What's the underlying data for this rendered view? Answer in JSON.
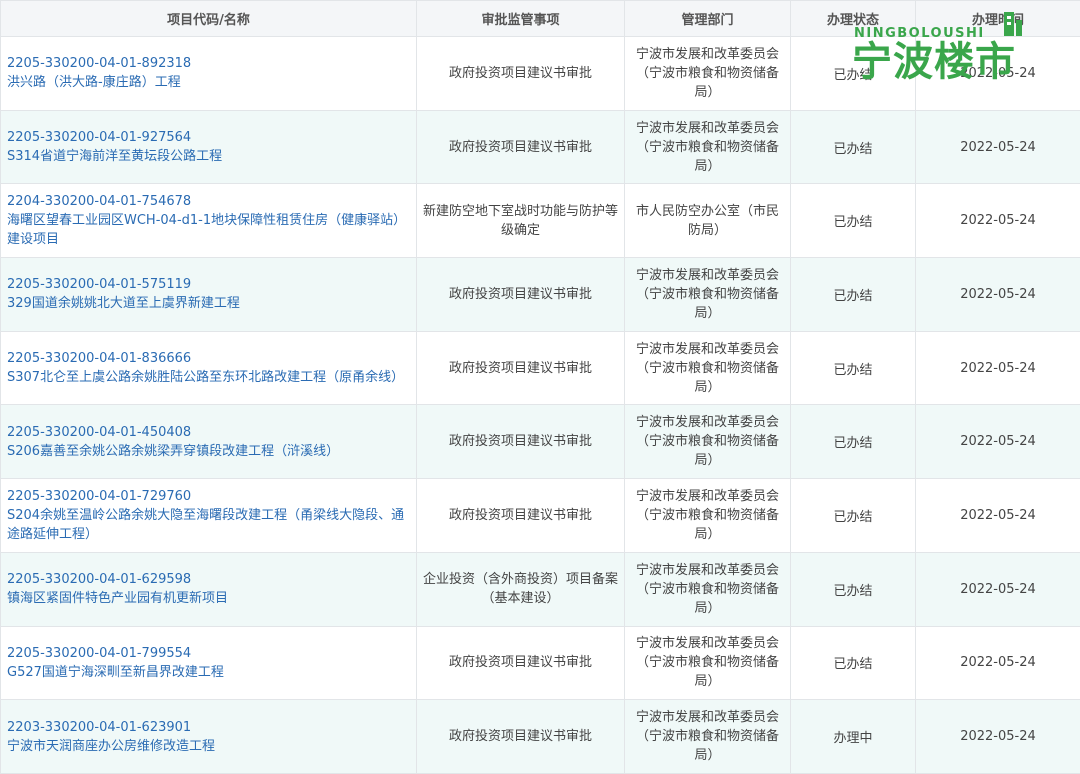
{
  "table": {
    "headers": {
      "project": "项目代码/名称",
      "item": "审批监管事项",
      "dept": "管理部门",
      "status": "办理状态",
      "time": "办理时间"
    },
    "rows": [
      {
        "code": "2205-330200-04-01-892318",
        "name": "洪兴路（洪大路-康庄路）工程",
        "item": "政府投资项目建议书审批",
        "dept": "宁波市发展和改革委员会（宁波市粮食和物资储备局）",
        "status": "已办结",
        "time": "2022-05-24"
      },
      {
        "code": "2205-330200-04-01-927564",
        "name": "S314省道宁海前洋至黄坛段公路工程",
        "item": "政府投资项目建议书审批",
        "dept": "宁波市发展和改革委员会（宁波市粮食和物资储备局）",
        "status": "已办结",
        "time": "2022-05-24"
      },
      {
        "code": "2204-330200-04-01-754678",
        "name": "海曙区望春工业园区WCH-04-d1-1地块保障性租赁住房（健康驿站）建设项目",
        "item": "新建防空地下室战时功能与防护等级确定",
        "dept": "市人民防空办公室（市民防局）",
        "status": "已办结",
        "time": "2022-05-24"
      },
      {
        "code": "2205-330200-04-01-575119",
        "name": "329国道余姚姚北大道至上虞界新建工程",
        "item": "政府投资项目建议书审批",
        "dept": "宁波市发展和改革委员会（宁波市粮食和物资储备局）",
        "status": "已办结",
        "time": "2022-05-24"
      },
      {
        "code": "2205-330200-04-01-836666",
        "name": "S307北仑至上虞公路余姚胜陆公路至东环北路改建工程（原甬余线）",
        "item": "政府投资项目建议书审批",
        "dept": "宁波市发展和改革委员会（宁波市粮食和物资储备局）",
        "status": "已办结",
        "time": "2022-05-24"
      },
      {
        "code": "2205-330200-04-01-450408",
        "name": "S206嘉善至余姚公路余姚梁弄穿镇段改建工程（浒溪线）",
        "item": "政府投资项目建议书审批",
        "dept": "宁波市发展和改革委员会（宁波市粮食和物资储备局）",
        "status": "已办结",
        "time": "2022-05-24"
      },
      {
        "code": "2205-330200-04-01-729760",
        "name": "S204余姚至温岭公路余姚大隐至海曙段改建工程（甬梁线大隐段、通途路延伸工程）",
        "item": "政府投资项目建议书审批",
        "dept": "宁波市发展和改革委员会（宁波市粮食和物资储备局）",
        "status": "已办结",
        "time": "2022-05-24"
      },
      {
        "code": "2205-330200-04-01-629598",
        "name": "镇海区紧固件特色产业园有机更新项目",
        "item": "企业投资（含外商投资）项目备案（基本建设）",
        "dept": "宁波市发展和改革委员会（宁波市粮食和物资储备局）",
        "status": "已办结",
        "time": "2022-05-24"
      },
      {
        "code": "2205-330200-04-01-799554",
        "name": "G527国道宁海深甽至新昌界改建工程",
        "item": "政府投资项目建议书审批",
        "dept": "宁波市发展和改革委员会（宁波市粮食和物资储备局）",
        "status": "已办结",
        "time": "2022-05-24"
      },
      {
        "code": "2203-330200-04-01-623901",
        "name": "宁波市天润商座办公房维修改造工程",
        "item": "政府投资项目建议书审批",
        "dept": "宁波市发展和改革委员会（宁波市粮食和物资储备局）",
        "status": "办理中",
        "time": "2022-05-24"
      }
    ]
  },
  "watermark": {
    "en": "NINGBOLOUSHI",
    "cn": "宁波楼市",
    "color": "#3aa64b"
  },
  "colors": {
    "link": "#2a6bb3",
    "header_bg": "#f4f6f8",
    "stripe_bg": "#f0f9f8",
    "border": "#e2e5e8"
  }
}
